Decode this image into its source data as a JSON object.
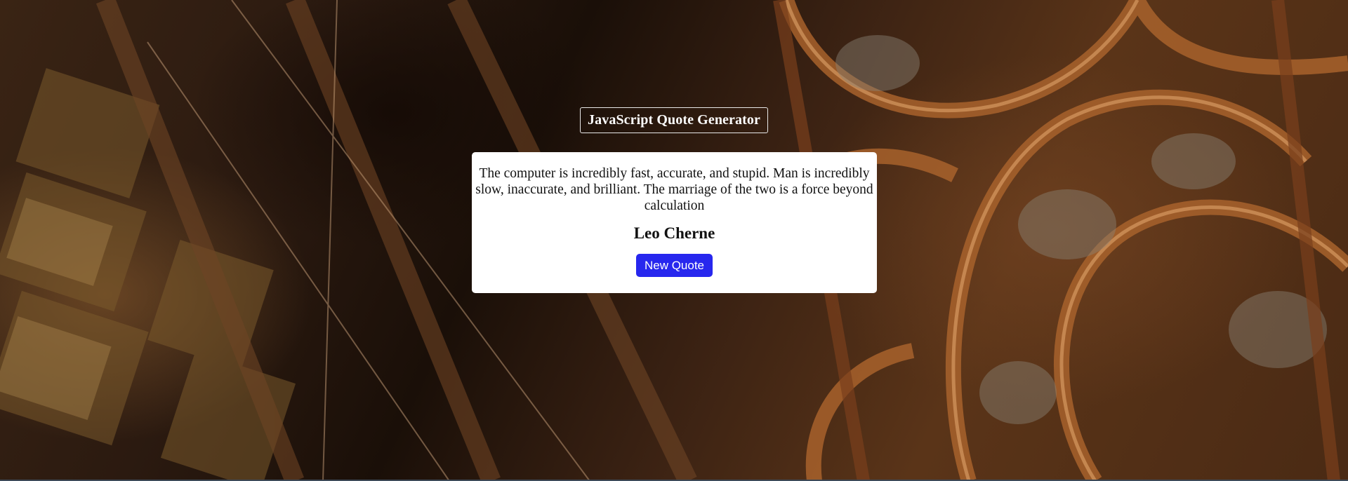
{
  "header": {
    "title": "JavaScript Quote Generator"
  },
  "quote": {
    "text": "The computer is incredibly fast, accurate, and stupid. Man is incredibly slow, inaccurate, and brilliant. The marriage of the two is a force beyond calculation",
    "author": "Leo Cherne"
  },
  "actions": {
    "new_quote_label": "New Quote"
  },
  "colors": {
    "button_background": "#2727ee",
    "card_background": "#ffffff",
    "title_border": "#e8e8e8"
  }
}
